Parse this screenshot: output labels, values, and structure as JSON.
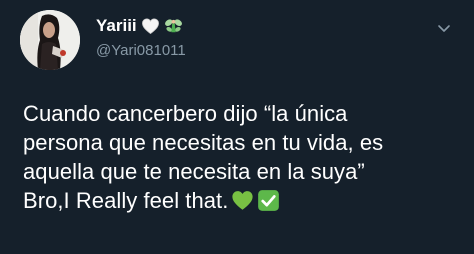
{
  "author": {
    "display_name": "Yariii",
    "name_emojis": [
      "white-heart-icon",
      "fairy-icon"
    ],
    "handle": "@Yari081011",
    "avatar": "profile-photo"
  },
  "tweet": {
    "lines": [
      "Cuando cancerbero dijo “la única",
      "persona que necesitas en tu vida, es",
      "aquella que te necesita en la suya”",
      "Bro,I Really feel that."
    ],
    "trailing_emojis": [
      "green-heart-icon",
      "check-mark-button-icon"
    ]
  },
  "menu": {
    "icon": "chevron-down-icon"
  },
  "colors": {
    "background": "#15202b",
    "text": "#ffffff",
    "secondary_text": "#8899a6",
    "green_heart": "#78c043",
    "check_green": "#5db84a"
  }
}
